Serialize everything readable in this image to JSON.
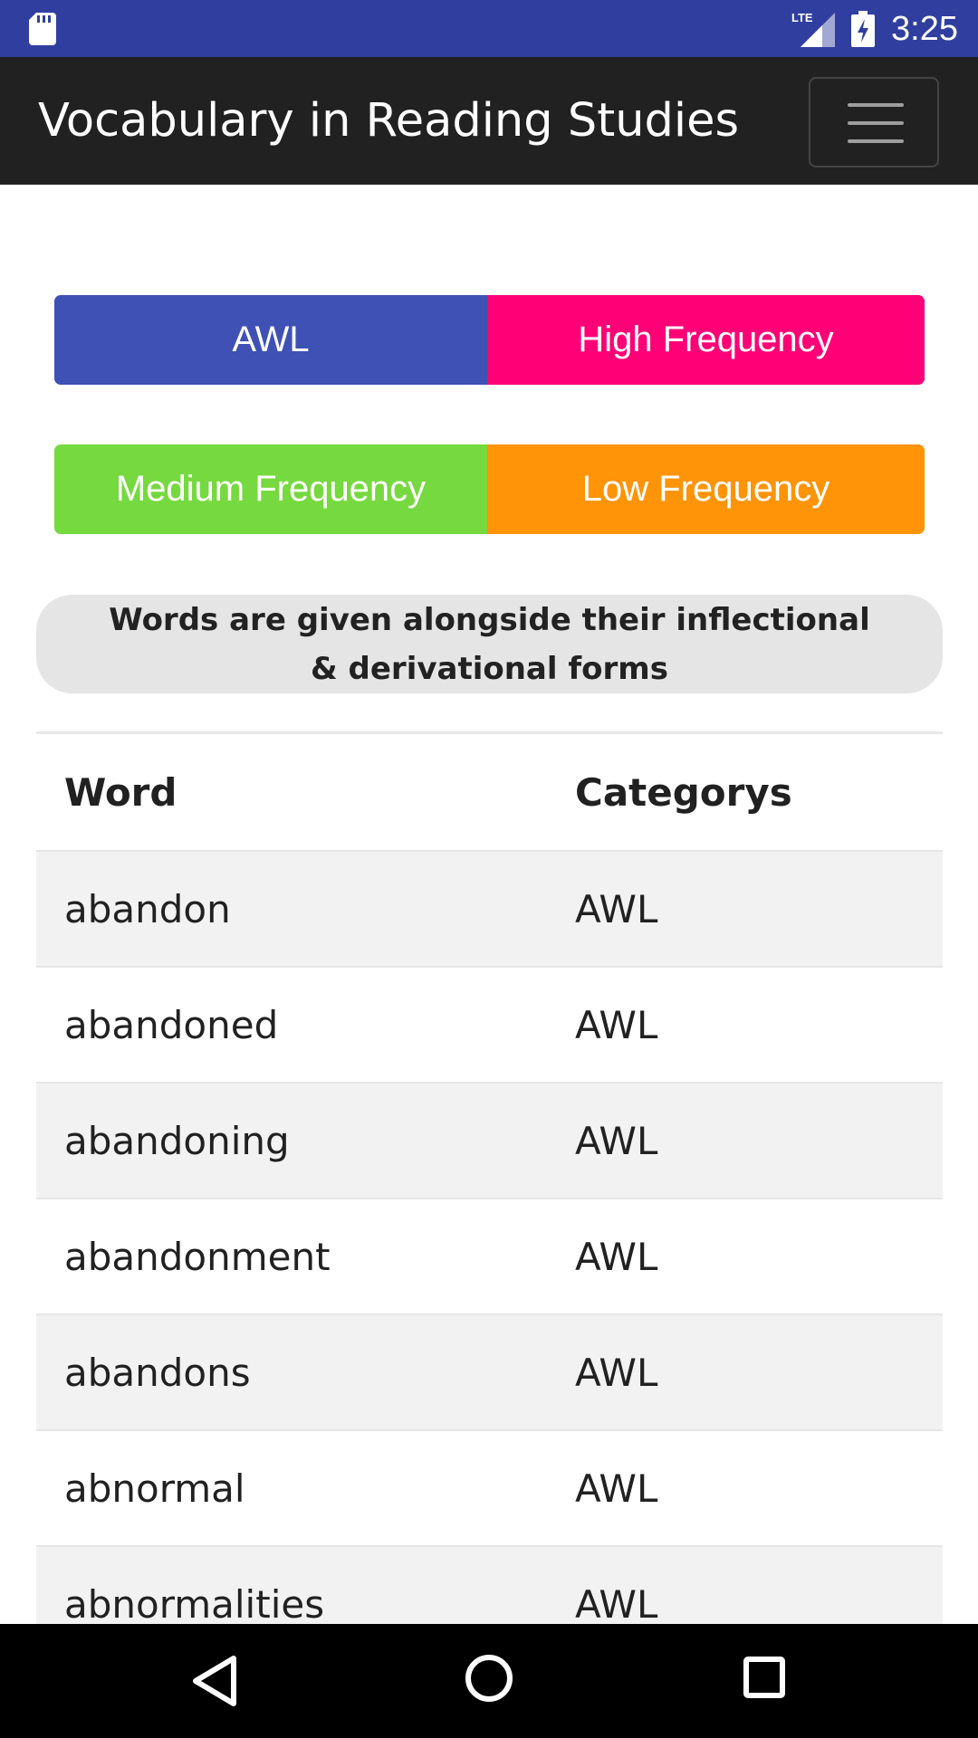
{
  "status_bar": {
    "time": "3:25",
    "network": "LTE",
    "icons": [
      "sd-card-icon",
      "lte-signal-icon",
      "battery-charging-icon"
    ],
    "background": "#303f9f"
  },
  "app_bar": {
    "title": "Vocabulary in Reading Studies",
    "menu_icon": "hamburger-menu-icon",
    "background": "#212121"
  },
  "categories": [
    {
      "label": "AWL",
      "color": "#3f51b5"
    },
    {
      "label": "High Frequency",
      "color": "#ff0077"
    },
    {
      "label": "Medium Frequency",
      "color": "#76d93f"
    },
    {
      "label": "Low Frequency",
      "color": "#ff9408"
    }
  ],
  "note": "Words are given alongside their inflectional & derivational forms",
  "table": {
    "headers": {
      "word": "Word",
      "category": "Categorys"
    },
    "rows": [
      {
        "word": "abandon",
        "category": "AWL"
      },
      {
        "word": "abandoned",
        "category": "AWL"
      },
      {
        "word": "abandoning",
        "category": "AWL"
      },
      {
        "word": "abandonment",
        "category": "AWL"
      },
      {
        "word": "abandons",
        "category": "AWL"
      },
      {
        "word": "abnormal",
        "category": "AWL"
      },
      {
        "word": "abnormalities",
        "category": "AWL"
      }
    ]
  },
  "nav_bar": {
    "icons": [
      "back-icon",
      "home-icon",
      "recent-apps-icon"
    ]
  }
}
